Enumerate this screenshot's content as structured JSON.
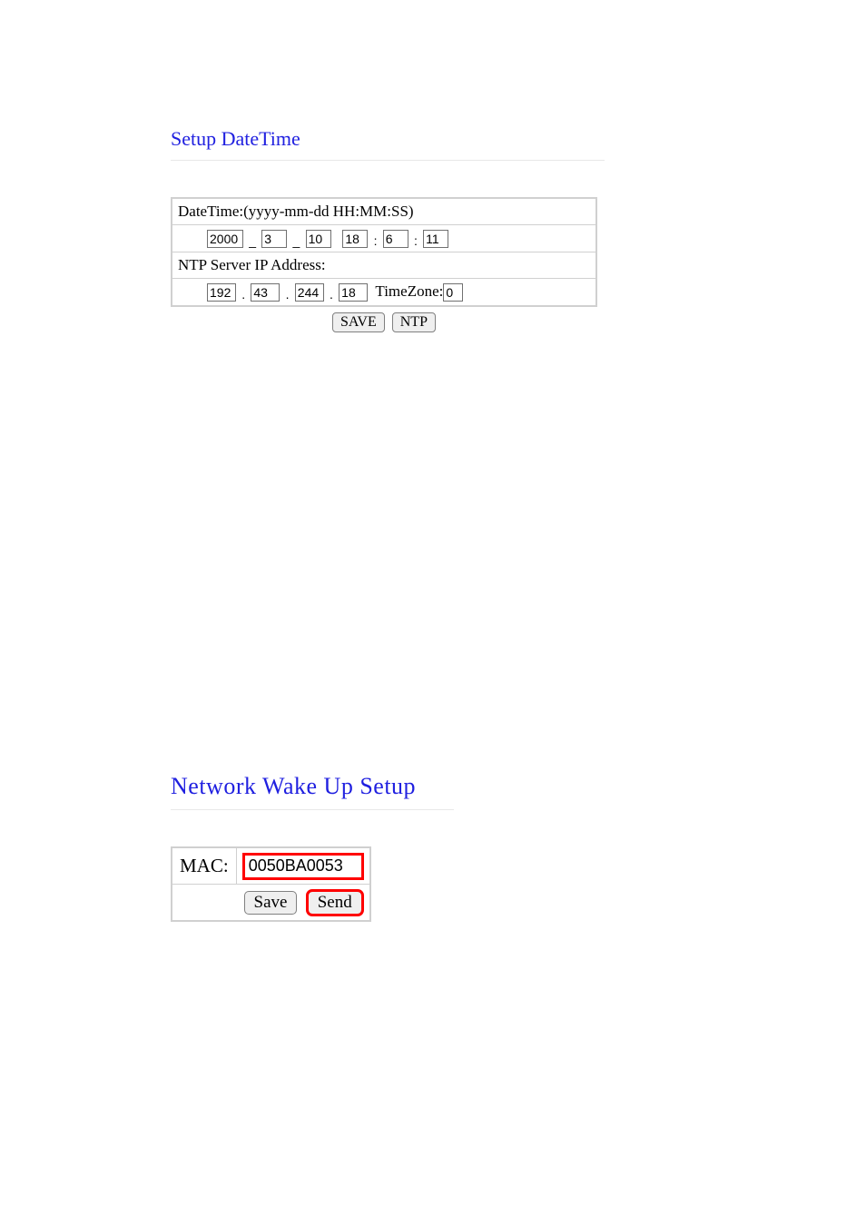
{
  "datetime_section": {
    "title": "Setup DateTime",
    "datetime_label": "DateTime:(yyyy-mm-dd HH:MM:SS)",
    "year": "2000",
    "month": "3",
    "day": "10",
    "hour": "18",
    "minute": "6",
    "second": "11",
    "sep_dash": "_",
    "sep_colon": ":",
    "ntp_label": "NTP Server IP Address:",
    "ip1": "192",
    "ip2": "43",
    "ip3": "244",
    "ip4": "18",
    "sep_dot": ".",
    "timezone_label": "TimeZone:",
    "timezone": "0",
    "save_btn": "SAVE",
    "ntp_btn": "NTP"
  },
  "wakeup_section": {
    "title": "Network Wake Up Setup",
    "mac_label": "MAC:",
    "mac_value": "0050BA0053",
    "save_btn": "Save",
    "send_btn": "Send"
  }
}
